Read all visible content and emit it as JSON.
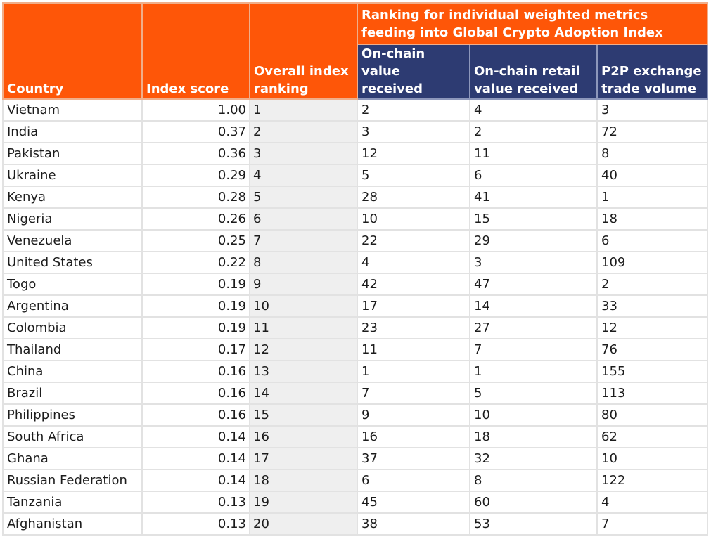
{
  "table": {
    "headers": {
      "country": "Country",
      "index_score": "Index score",
      "overall_ranking": "Overall index ranking",
      "group": "Ranking for individual weighted metrics feeding into Global Crypto Adoption Index",
      "onchain_value": "On-chain value received",
      "onchain_retail": "On-chain retail value received",
      "p2p_volume": "P2P exchange trade volume"
    },
    "colors": {
      "header_orange": "#fe5608",
      "header_navy": "#2d3b72",
      "rank_column_bg": "#efefef"
    },
    "rows": [
      {
        "country": "Vietnam",
        "score": "1.00",
        "rank": "1",
        "onchain": "2",
        "retail": "4",
        "p2p": "3"
      },
      {
        "country": "India",
        "score": "0.37",
        "rank": "2",
        "onchain": "3",
        "retail": "2",
        "p2p": "72"
      },
      {
        "country": "Pakistan",
        "score": "0.36",
        "rank": "3",
        "onchain": "12",
        "retail": "11",
        "p2p": "8"
      },
      {
        "country": "Ukraine",
        "score": "0.29",
        "rank": "4",
        "onchain": "5",
        "retail": "6",
        "p2p": "40"
      },
      {
        "country": "Kenya",
        "score": "0.28",
        "rank": "5",
        "onchain": "28",
        "retail": "41",
        "p2p": "1"
      },
      {
        "country": "Nigeria",
        "score": "0.26",
        "rank": "6",
        "onchain": "10",
        "retail": "15",
        "p2p": "18"
      },
      {
        "country": "Venezuela",
        "score": "0.25",
        "rank": "7",
        "onchain": "22",
        "retail": "29",
        "p2p": "6"
      },
      {
        "country": "United States",
        "score": "0.22",
        "rank": "8",
        "onchain": "4",
        "retail": "3",
        "p2p": "109"
      },
      {
        "country": "Togo",
        "score": "0.19",
        "rank": "9",
        "onchain": "42",
        "retail": "47",
        "p2p": "2"
      },
      {
        "country": "Argentina",
        "score": "0.19",
        "rank": "10",
        "onchain": "17",
        "retail": "14",
        "p2p": "33"
      },
      {
        "country": "Colombia",
        "score": "0.19",
        "rank": "11",
        "onchain": "23",
        "retail": "27",
        "p2p": "12"
      },
      {
        "country": "Thailand",
        "score": "0.17",
        "rank": "12",
        "onchain": "11",
        "retail": "7",
        "p2p": "76"
      },
      {
        "country": "China",
        "score": "0.16",
        "rank": "13",
        "onchain": "1",
        "retail": "1",
        "p2p": "155"
      },
      {
        "country": "Brazil",
        "score": "0.16",
        "rank": "14",
        "onchain": "7",
        "retail": "5",
        "p2p": "113"
      },
      {
        "country": "Philippines",
        "score": "0.16",
        "rank": "15",
        "onchain": "9",
        "retail": "10",
        "p2p": "80"
      },
      {
        "country": "South Africa",
        "score": "0.14",
        "rank": "16",
        "onchain": "16",
        "retail": "18",
        "p2p": "62"
      },
      {
        "country": "Ghana",
        "score": "0.14",
        "rank": "17",
        "onchain": "37",
        "retail": "32",
        "p2p": "10"
      },
      {
        "country": "Russian Federation",
        "score": "0.14",
        "rank": "18",
        "onchain": "6",
        "retail": "8",
        "p2p": "122"
      },
      {
        "country": "Tanzania",
        "score": "0.13",
        "rank": "19",
        "onchain": "45",
        "retail": "60",
        "p2p": "4"
      },
      {
        "country": "Afghanistan",
        "score": "0.13",
        "rank": "20",
        "onchain": "38",
        "retail": "53",
        "p2p": "7"
      }
    ]
  }
}
